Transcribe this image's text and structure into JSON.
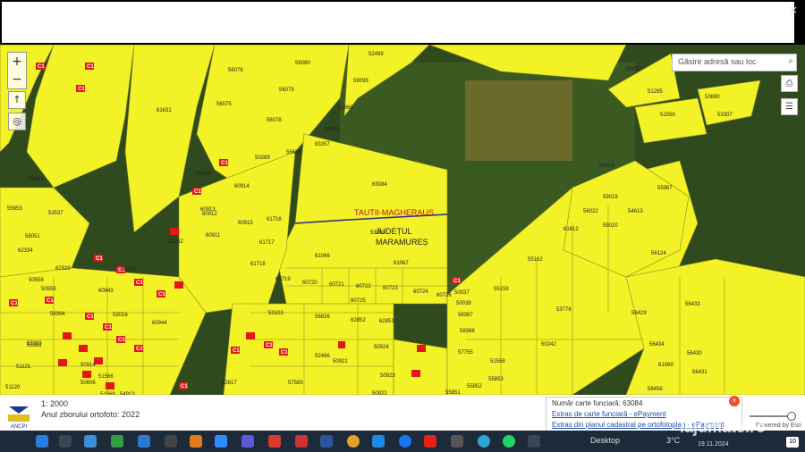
{
  "window": {
    "close_glyph": "×"
  },
  "map": {
    "zoom_in": "+",
    "zoom_out": "−",
    "search_placeholder": "Găsire adresă sau loc",
    "places": {
      "admin_line": "TAUTII-MAGHERAUS",
      "county": "JUDEȚUL MARAMUREȘ"
    },
    "parcels": [
      "52499",
      "56080",
      "56076",
      "56079",
      "59099",
      "56075",
      "56078",
      "61631",
      "61860",
      "62003",
      "83357",
      "50289",
      "56685",
      "63084",
      "53900",
      "61716",
      "61717",
      "61718",
      "61066",
      "61067",
      "60719",
      "60720",
      "60721",
      "60722",
      "60723",
      "60724",
      "60725",
      "60726",
      "50037",
      "50038",
      "58387",
      "58388",
      "57755",
      "56826",
      "62852",
      "62851",
      "53103",
      "52466",
      "50921",
      "50923",
      "50924",
      "50922",
      "57583",
      "52817",
      "55851",
      "55852",
      "55853",
      "51558",
      "50242",
      "55159",
      "55162",
      "53776",
      "61612",
      "59018",
      "59019",
      "59020",
      "56022",
      "54613",
      "55967",
      "56124",
      "56429",
      "56433",
      "56434",
      "56430",
      "56431",
      "56456",
      "61069",
      "56827",
      "51295",
      "51559",
      "53307",
      "53690",
      "61595",
      "60914",
      "60913",
      "60912",
      "60911",
      "60915",
      "62262",
      "56674",
      "55953",
      "53537",
      "58051",
      "62334",
      "62329",
      "55761",
      "60943",
      "50558",
      "50559",
      "56394",
      "53016",
      "60944",
      "53382",
      "53383",
      "51121",
      "51120",
      "50914",
      "51566",
      "51569",
      "54913",
      "50606",
      "53018"
    ],
    "building_tag": "C1"
  },
  "bottom": {
    "scale": "1: 2000",
    "ortho": "Anul zborului ortofoto: 2022",
    "popup_title": "Număr carte funciară: 63084",
    "link1": "Extras de carte funciară - ePayment",
    "link2": "Extras din planul cadastral pe ortofotoplan - ePayment",
    "powered": "Powered by Esri",
    "logo_text": "ANCPI"
  },
  "taskbar": {
    "desktop": "Desktop",
    "temp": "3°C",
    "date": "19.11.2024",
    "notif": "10",
    "watermark": "lajumate.ro"
  },
  "colors": {
    "parcel": "#f2f226",
    "forest": "#2f4a1c",
    "building": "#e01818"
  }
}
